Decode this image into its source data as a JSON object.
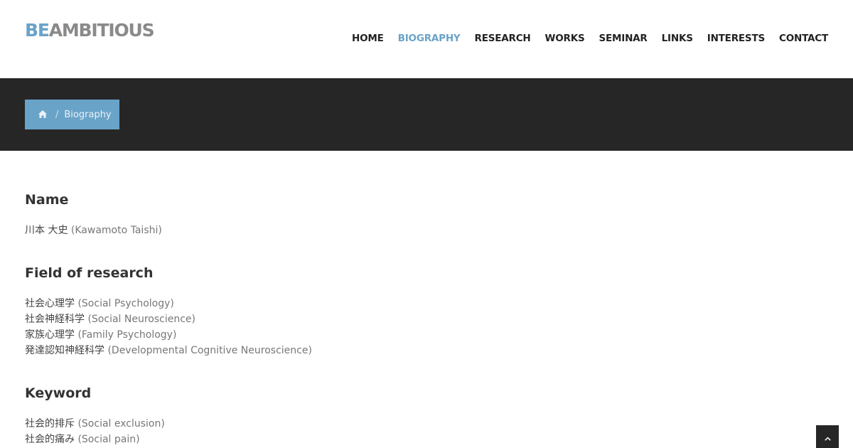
{
  "logo": {
    "accent": "BE",
    "rest": "AMBITIOUS"
  },
  "nav": {
    "items": [
      {
        "label": "HOME"
      },
      {
        "label": "BIOGRAPHY"
      },
      {
        "label": "RESEARCH"
      },
      {
        "label": "WORKS"
      },
      {
        "label": "SEMINAR"
      },
      {
        "label": "LINKS"
      },
      {
        "label": "INTERESTS"
      },
      {
        "label": "CONTACT"
      }
    ],
    "active": "BIOGRAPHY"
  },
  "breadcrumb": {
    "separator": "/",
    "current": "Biography",
    "home_icon": "home-icon"
  },
  "sections": {
    "name": {
      "title": "Name",
      "lines": [
        {
          "ja": "川本 大史",
          "en": "(Kawamoto Taishi)"
        }
      ]
    },
    "field": {
      "title": "Field of research",
      "lines": [
        {
          "ja": "社会心理学",
          "en": "(Social Psychology)"
        },
        {
          "ja": "社会神経科学",
          "en": "(Social Neuroscience)"
        },
        {
          "ja": "家族心理学",
          "en": "(Family Psychology)"
        },
        {
          "ja": "発達認知神経科学",
          "en": "(Developmental Cognitive Neuroscience)"
        }
      ]
    },
    "keyword": {
      "title": "Keyword",
      "lines": [
        {
          "ja": "社会的排斥",
          "en": "(Social exclusion)"
        },
        {
          "ja": "社会的痛み",
          "en": "(Social pain)"
        }
      ]
    }
  },
  "colors": {
    "accent": "#6aa3c8",
    "dark_band": "#262626"
  },
  "scroll_top_icon": "chevron-up-icon"
}
